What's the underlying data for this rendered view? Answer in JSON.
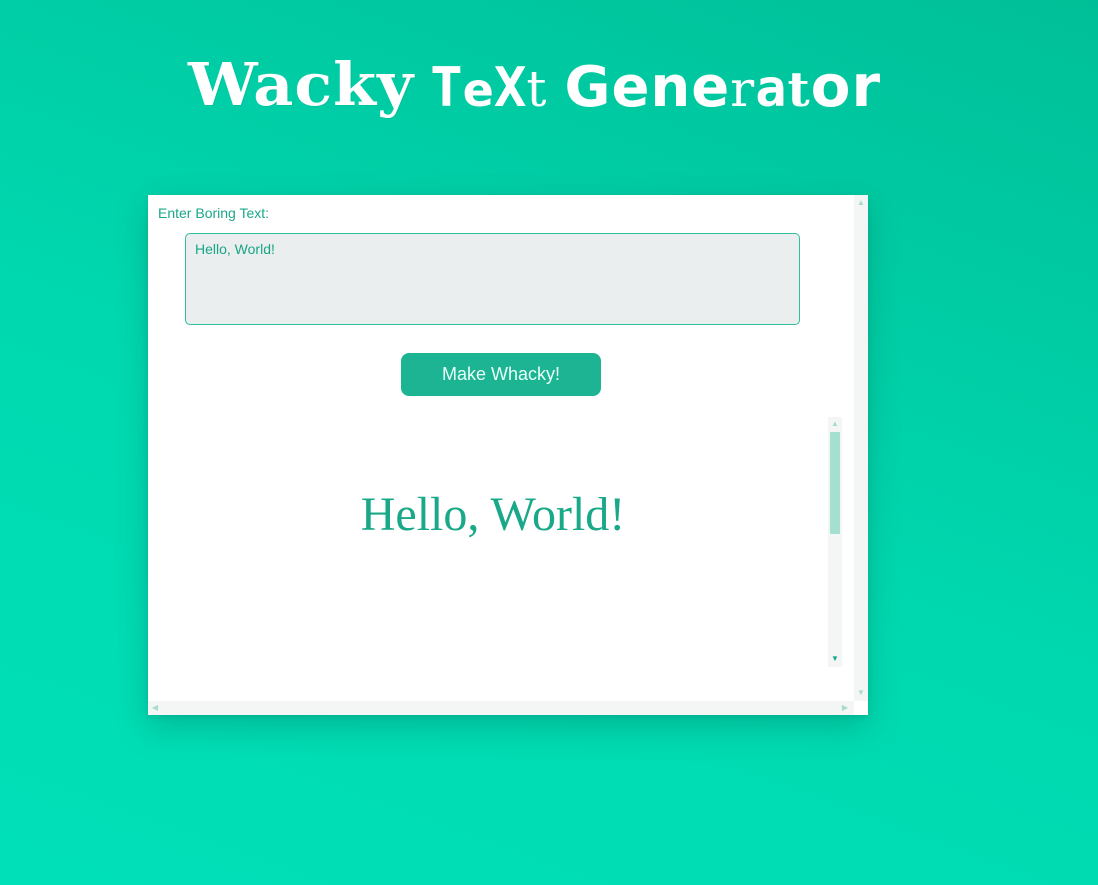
{
  "title": {
    "part1": "Wacky",
    "part2_a": "T",
    "part2_b": "e",
    "part2_c": "X",
    "part2_d": "t",
    "part3_a": "Gene",
    "part3_b": "r",
    "part3_c": "a",
    "part3_d": "t",
    "part3_e": "or"
  },
  "form": {
    "label": "Enter Boring Text:",
    "input_value": "Hello, World!",
    "button_label": "Make Whacky!"
  },
  "output": {
    "text": "Hello, World!"
  },
  "colors": {
    "accent": "#1cb493",
    "background": "#00d9b0",
    "text": "#19a888"
  }
}
